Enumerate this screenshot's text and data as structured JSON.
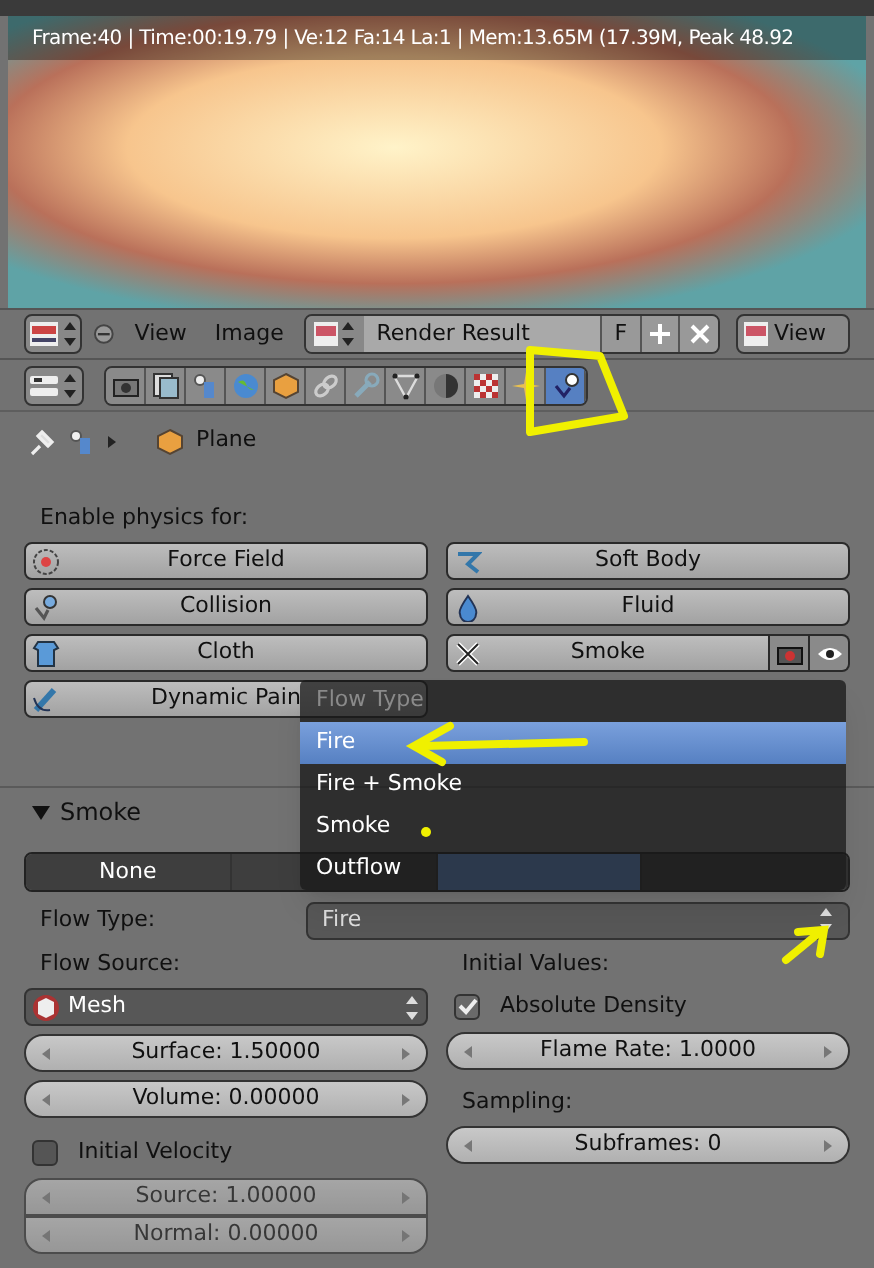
{
  "render_view": {
    "info": "Frame:40 | Time:00:19.79 | Ve:12 Fa:14 La:1 | Mem:13.65M (17.39M, Peak 48.92"
  },
  "image_header": {
    "menus": [
      "View",
      "Image"
    ],
    "image_name": "Render Result",
    "fake_user": "F",
    "view_menu": "View"
  },
  "properties_tabs": [
    {
      "kind": "render",
      "selected": false
    },
    {
      "kind": "layers",
      "selected": false
    },
    {
      "kind": "scene",
      "selected": false
    },
    {
      "kind": "world",
      "selected": false
    },
    {
      "kind": "object",
      "selected": false
    },
    {
      "kind": "constraints",
      "selected": false
    },
    {
      "kind": "modifiers",
      "selected": false
    },
    {
      "kind": "data",
      "selected": false
    },
    {
      "kind": "material",
      "selected": false
    },
    {
      "kind": "texture",
      "selected": false
    },
    {
      "kind": "particles",
      "selected": false
    },
    {
      "kind": "physics",
      "selected": true
    }
  ],
  "breadcrumb": {
    "object": "Plane"
  },
  "physics": {
    "label": "Enable physics for:",
    "buttons": [
      {
        "label": "Force Field",
        "kind": "force-field",
        "enabled": false
      },
      {
        "label": "Soft Body",
        "kind": "soft-body",
        "enabled": false
      },
      {
        "label": "Collision",
        "kind": "collision",
        "enabled": false
      },
      {
        "label": "Fluid",
        "kind": "fluid",
        "enabled": false
      },
      {
        "label": "Cloth",
        "kind": "cloth",
        "enabled": false
      },
      {
        "label": "Smoke",
        "kind": "smoke",
        "enabled": true
      },
      {
        "label": "Dynamic Pain",
        "kind": "dynamic-paint",
        "enabled": false
      }
    ]
  },
  "smoke_panel": {
    "title": "Smoke",
    "expanded": true,
    "types": [
      {
        "label": "None",
        "selected": false
      },
      {
        "selected": false
      },
      {
        "selected": true
      },
      {
        "selected": false
      }
    ],
    "flow_type": {
      "label": "Flow Type:",
      "value": "Fire"
    },
    "flow_source": {
      "label": "Flow Source:",
      "value": "Mesh"
    },
    "surface": {
      "text": "Surface: 1.50000",
      "disabled": false
    },
    "volume": {
      "text": "Volume: 0.00000",
      "disabled": false
    },
    "initial_velocity": {
      "label": "Initial Velocity",
      "checked": false
    },
    "source": {
      "text": "Source: 1.00000",
      "disabled": true
    },
    "normal": {
      "text": "Normal: 0.00000",
      "disabled": true
    },
    "initial_values": {
      "label": "Initial Values:"
    },
    "absolute_density": {
      "label": "Absolute Density",
      "checked": true
    },
    "flame_rate": {
      "text": "Flame Rate: 1.0000",
      "disabled": false
    },
    "sampling": {
      "label": "Sampling:"
    },
    "subframes": {
      "text": "Subframes: 0",
      "disabled": false
    }
  },
  "flow_type_menu": {
    "title": "Flow Type",
    "items": [
      {
        "label": "Fire",
        "selected": true
      },
      {
        "label": "Fire + Smoke",
        "selected": false
      },
      {
        "label": "Smoke",
        "selected": false
      },
      {
        "label": "Outflow",
        "selected": false
      }
    ]
  }
}
